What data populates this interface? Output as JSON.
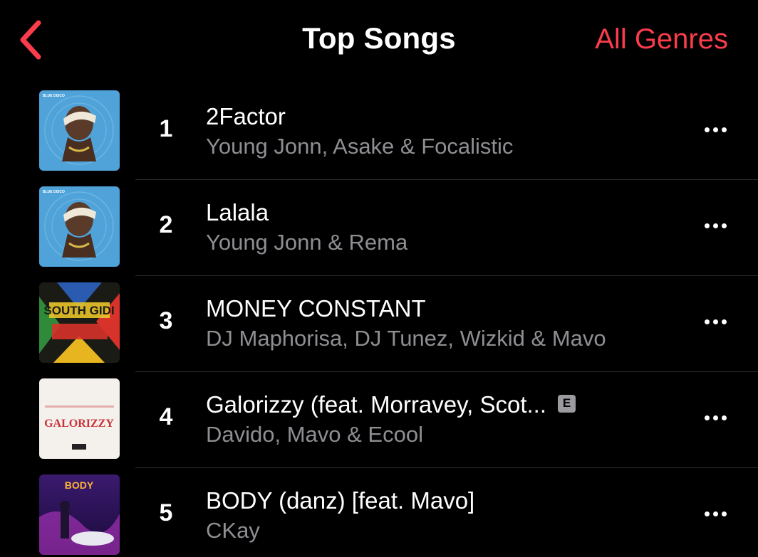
{
  "header": {
    "title": "Top Songs",
    "genre_button": "All Genres"
  },
  "colors": {
    "accent": "#fa3c4c",
    "secondary_text": "#8e8e93",
    "background": "#000000"
  },
  "songs": [
    {
      "rank": "1",
      "title": "2Factor",
      "artist": "Young Jonn, Asake & Focalistic",
      "explicit": false,
      "art_label": "BLUE DISCO"
    },
    {
      "rank": "2",
      "title": "Lalala",
      "artist": "Young Jonn & Rema",
      "explicit": false,
      "art_label": "BLUE DISCO"
    },
    {
      "rank": "3",
      "title": "MONEY CONSTANT",
      "artist": "DJ Maphorisa, DJ Tunez, Wizkid & Mavo",
      "explicit": false,
      "art_label": "SOUTH GIDI"
    },
    {
      "rank": "4",
      "title": "Galorizzy (feat. Morravey, Scot...",
      "artist": "Davido, Mavo & Ecool",
      "explicit": true,
      "explicit_label": "E",
      "art_label": "GALORIZZY"
    },
    {
      "rank": "5",
      "title": "BODY (danz) [feat. Mavo]",
      "artist": "CKay",
      "explicit": false,
      "art_label": "BODY"
    }
  ]
}
